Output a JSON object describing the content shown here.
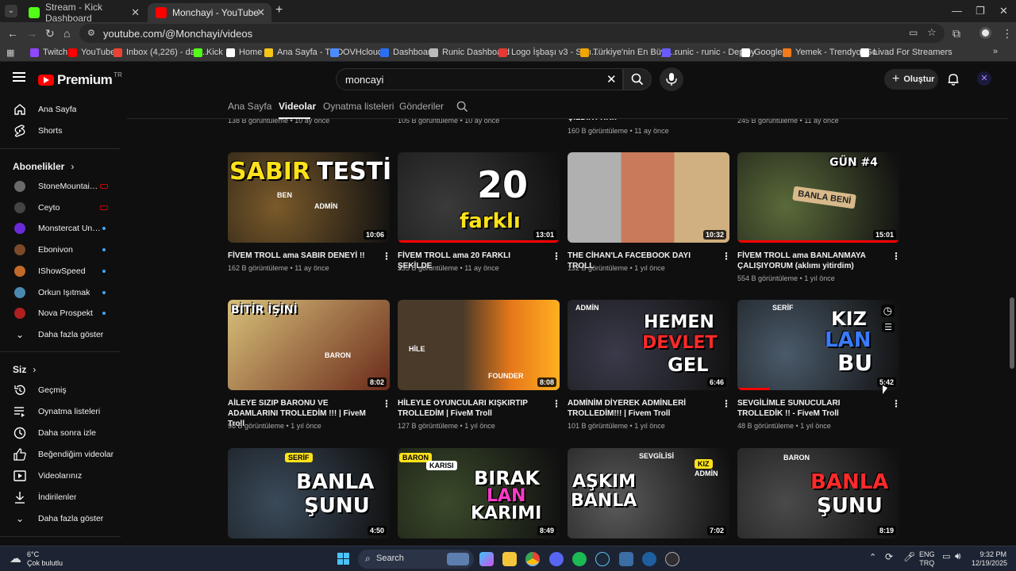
{
  "browser": {
    "tabs": [
      {
        "title": "Stream - Kick Dashboard",
        "color": "#53fc18"
      },
      {
        "title": "Monchayi - YouTube",
        "color": "#ff0000"
      }
    ],
    "new_tab": "+",
    "url": "youtube.com/@Monchayi/videos",
    "bookmarks": [
      {
        "label": "Twitch",
        "color": "#9146ff"
      },
      {
        "label": "YouTube",
        "color": "#ff0000"
      },
      {
        "label": "Inbox (4,226) - dag...",
        "color": "#ea4335"
      },
      {
        "label": "Kick",
        "color": "#53fc18"
      },
      {
        "label": "Home",
        "color": "#ffffff"
      },
      {
        "label": "Ana Sayfa - TOD",
        "color": "#f5c518"
      },
      {
        "label": "OVHcloud",
        "color": "#4c8cff"
      },
      {
        "label": "Dashboard",
        "color": "#2a6ef5"
      },
      {
        "label": "Runic Dashboard",
        "color": "#bbbbbb"
      },
      {
        "label": "Logo İşbaşı v3 - Satı...",
        "color": "#e53935"
      },
      {
        "label": "Türkiye'nin En Büyü...",
        "color": "#f0a500"
      },
      {
        "label": "runic - runic - Deploy",
        "color": "#6b5bff"
      },
      {
        "label": "Google",
        "color": "#ffffff"
      },
      {
        "label": "Yemek - Trendyol Go",
        "color": "#f27a1a"
      },
      {
        "label": "Livad For Streamers",
        "color": "#ffffff"
      }
    ]
  },
  "header": {
    "logo_text": "Premium",
    "logo_region": "TR",
    "search_value": "moncayi",
    "create_label": "Oluştur"
  },
  "sidebar": {
    "main": [
      {
        "label": "Ana Sayfa"
      },
      {
        "label": "Shorts"
      }
    ],
    "subs_heading": "Abonelikler",
    "subscriptions": [
      {
        "label": "StoneMountain64",
        "status": "live",
        "color": "#6a6a6a"
      },
      {
        "label": "Ceyto",
        "status": "live",
        "color": "#444444"
      },
      {
        "label": "Monstercat Unca...",
        "status": "new",
        "color": "#6a2ad8"
      },
      {
        "label": "Ebonivon",
        "status": "new",
        "color": "#7a4a2a"
      },
      {
        "label": "IShowSpeed",
        "status": "new",
        "color": "#c26a2a"
      },
      {
        "label": "Orkun Işıtmak",
        "status": "new",
        "color": "#4a8ab0"
      },
      {
        "label": "Nova Prospekt",
        "status": "new",
        "color": "#b02020"
      }
    ],
    "show_more_subs": "Daha fazla göster",
    "you_heading": "Siz",
    "you_items": [
      {
        "label": "Geçmiş"
      },
      {
        "label": "Oynatma listeleri"
      },
      {
        "label": "Daha sonra izle"
      },
      {
        "label": "Beğendiğim videolar"
      },
      {
        "label": "Videolarınız"
      },
      {
        "label": "İndirilenler"
      }
    ],
    "show_more_you": "Daha fazla göster"
  },
  "channel_tabs": [
    "Ana Sayfa",
    "Videolar",
    "Oynatma listeleri",
    "Gönderiler"
  ],
  "partial_row": [
    {
      "title": "",
      "meta": "138 B görüntüleme • 10 ay önce"
    },
    {
      "title": "",
      "meta": "105 B görüntüleme • 10 ay önce"
    },
    {
      "title": "ÇILDIRTTIK!!",
      "meta": "160 B görüntüleme • 11 ay önce"
    },
    {
      "title": "",
      "meta": "245 B görüntüleme • 11 ay önce"
    }
  ],
  "videos": [
    {
      "title": "FİVEM TROLL ama SABIR DENEYİ !!",
      "meta": "162 B görüntüleme • 11 ay önce",
      "duration": "10:06",
      "thumb_text": "SABIR TESTİ",
      "bg": "#7a5a2a"
    },
    {
      "title": "FİVEM TROLL ama 20 FARKLI ŞEKİLDE",
      "meta": "235 B görüntüleme • 11 ay önce",
      "duration": "13:01",
      "thumb_text": "20 farklı",
      "bg": "#3a3a3a"
    },
    {
      "title": "THE CİHAN'LA FACEBOOK DAYI TROLL",
      "meta": "132 B görüntüleme • 1 yıl önce",
      "duration": "10:32",
      "thumb_text": "",
      "bg": "#2a4ad0"
    },
    {
      "title": "FİVEM TROLL ama BANLANMAYA ÇALIŞIYORUM (aklımı yitirdim)",
      "meta": "554 B görüntüleme • 1 yıl önce",
      "duration": "15:01",
      "thumb_text": "GÜN #4",
      "sign": "BANLA BENİ",
      "bg": "#5a6a3a"
    },
    {
      "title": "AİLEYE SIZIP BARONU VE ADAMLARINI TROLLEDİM !!! | FiveM Troll",
      "meta": "98 B görüntüleme • 1 yıl önce",
      "duration": "8:02",
      "thumb_text": "BİTİR İŞİNİ",
      "bg": "#b08a3a"
    },
    {
      "title": "HİLEYLE OYUNCULARI KIŞKIRTIP TROLLEDİM | FiveM Troll",
      "meta": "127 B görüntüleme • 1 yıl önce",
      "duration": "8:08",
      "thumb_text": "HİLE",
      "bg": "#d05a1a"
    },
    {
      "title": "ADMİNİM DİYEREK ADMİNLERİ TROLLEDİM!!! | Fivem Troll",
      "meta": "101 B görüntüleme • 1 yıl önce",
      "duration": "6:46",
      "thumb_text": "HEMEN DEVLET GEL",
      "bg": "#3a3a4a"
    },
    {
      "title": "SEVGİLİMLE SUNUCULARI TROLLEDİK !! - FiveM Troll",
      "meta": "48 B görüntüleme • 1 yıl önce",
      "duration": "5:42",
      "thumb_text": "KIZ LAN BU",
      "bg": "#4a5a6a"
    },
    {
      "title": "",
      "meta": "",
      "duration": "4:50",
      "thumb_text": "BANLA ŞUNU",
      "bg": "#3a4a5a"
    },
    {
      "title": "",
      "meta": "",
      "duration": "8:49",
      "thumb_text": "BIRAK LAN KARIMI",
      "bg": "#3a4a2a"
    },
    {
      "title": "",
      "meta": "",
      "duration": "7:02",
      "thumb_text": "AŞKIM BANLA",
      "bg": "#5a5a5a"
    },
    {
      "title": "",
      "meta": "",
      "duration": "8:19",
      "thumb_text": "BANLA ŞUNU",
      "bg": "#4a4a4a"
    }
  ],
  "taskbar": {
    "weather_temp": "6°C",
    "weather_desc": "Çok bulutlu",
    "search_label": "Search",
    "lang_top": "ENG",
    "lang_bottom": "TRQ",
    "time": "9:32 PM",
    "date": "12/19/2025"
  }
}
